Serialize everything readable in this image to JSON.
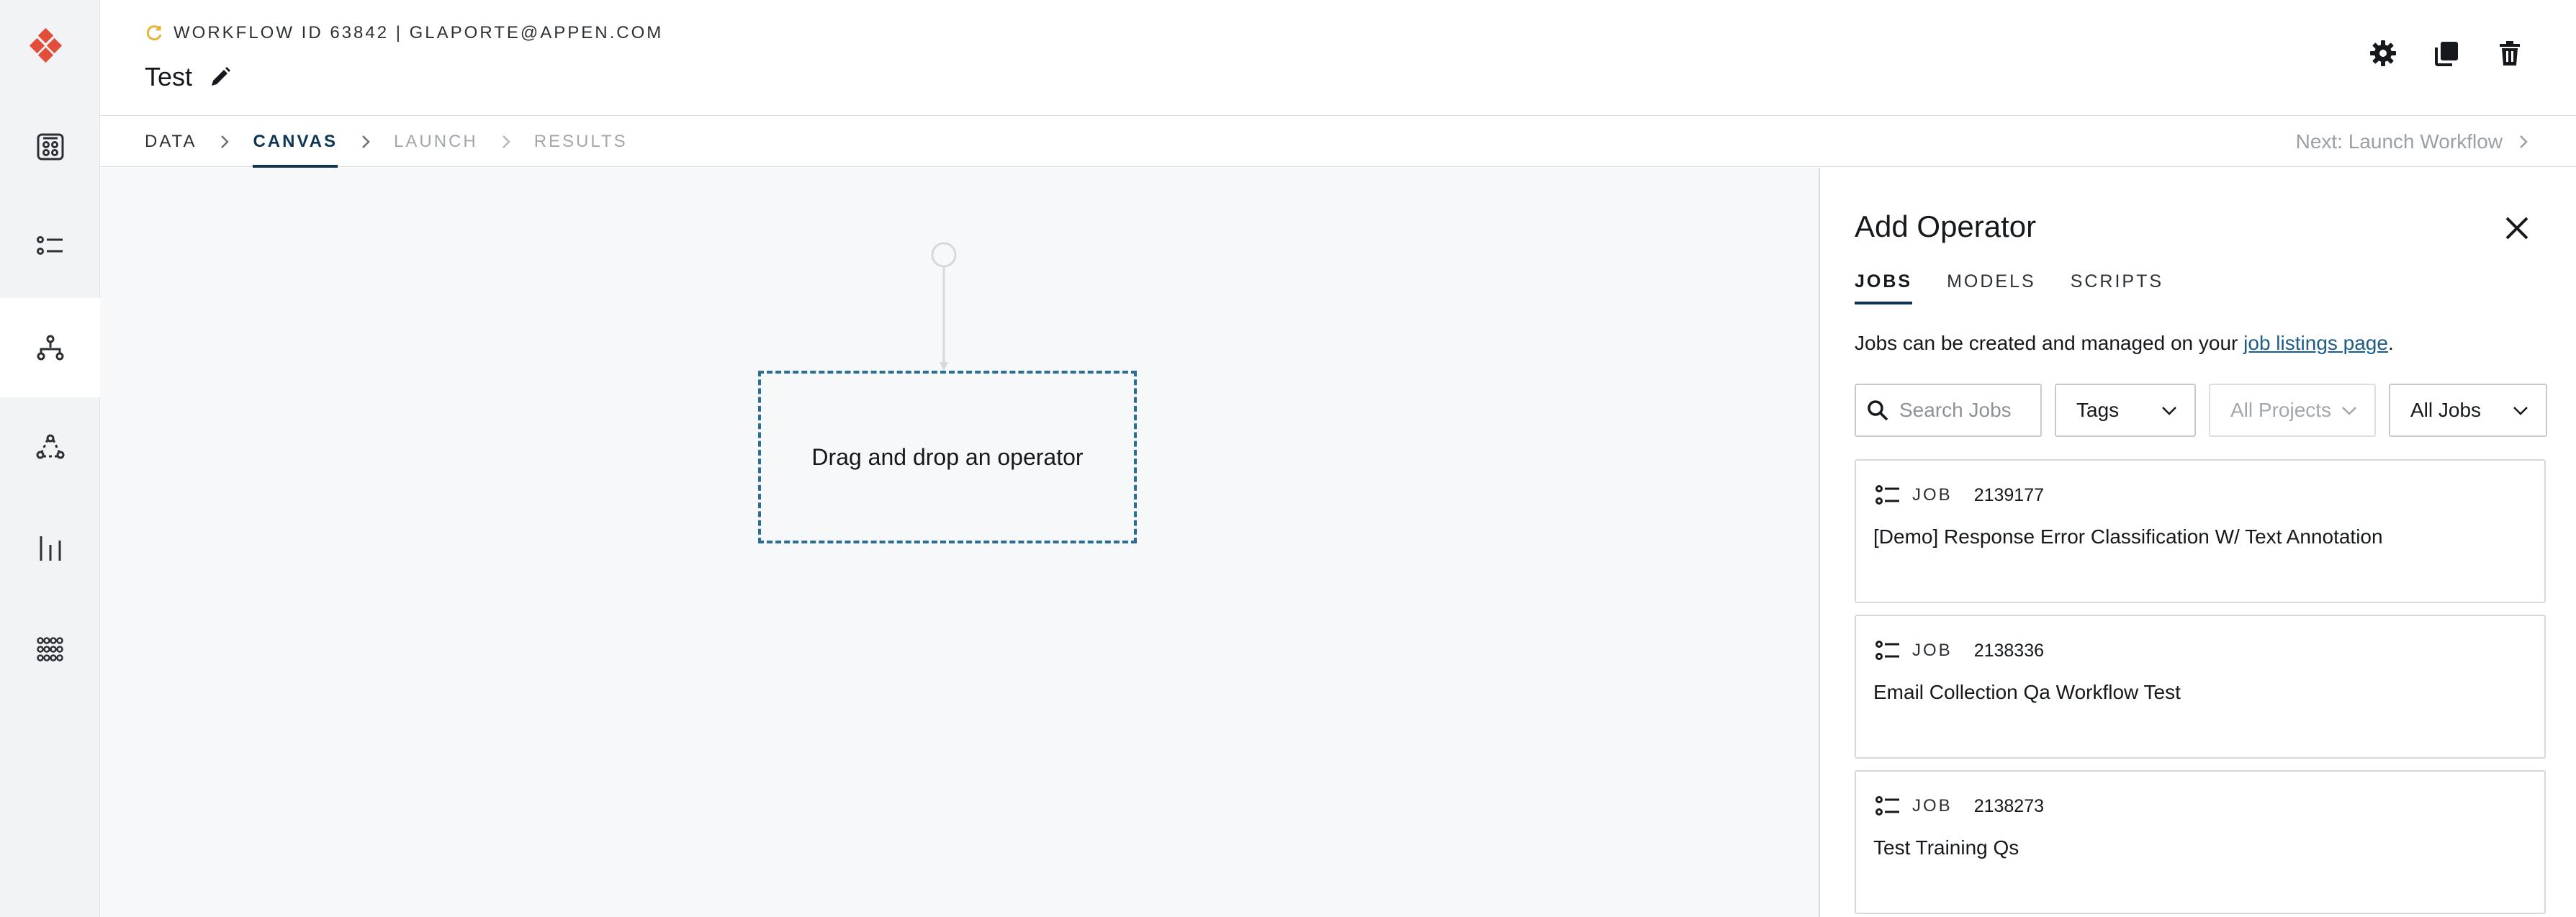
{
  "header": {
    "workflow_meta": "WORKFLOW ID 63842 | GLAPORTE@APPEN.COM",
    "title": "Test"
  },
  "steps": [
    {
      "label": "DATA",
      "state": "done"
    },
    {
      "label": "CANVAS",
      "state": "active"
    },
    {
      "label": "LAUNCH",
      "state": "disabled"
    },
    {
      "label": "RESULTS",
      "state": "disabled"
    }
  ],
  "next_step_label": "Next: Launch Workflow",
  "canvas": {
    "drop_zone_text": "Drag and drop an operator"
  },
  "panel": {
    "title": "Add Operator",
    "tabs": [
      "JOBS",
      "MODELS",
      "SCRIPTS"
    ],
    "info_prefix": "Jobs can be created and managed on your ",
    "info_link": "job listings page",
    "info_suffix": ".",
    "search_placeholder": "Search Jobs",
    "filter_tags": "Tags",
    "filter_projects": "All Projects",
    "filter_jobs": "All Jobs",
    "jobs": [
      {
        "type": "JOB",
        "id": "2139177",
        "name": "[Demo] Response Error Classification W/ Text Annotation"
      },
      {
        "type": "JOB",
        "id": "2138336",
        "name": "Email Collection Qa Workflow Test"
      },
      {
        "type": "JOB",
        "id": "2138273",
        "name": "Test Training Qs"
      }
    ]
  },
  "colors": {
    "brand": "#e14f3a",
    "accent": "#0d3656",
    "dropzone_border": "#2a6e95",
    "status_spinner": "#e8b53a"
  }
}
